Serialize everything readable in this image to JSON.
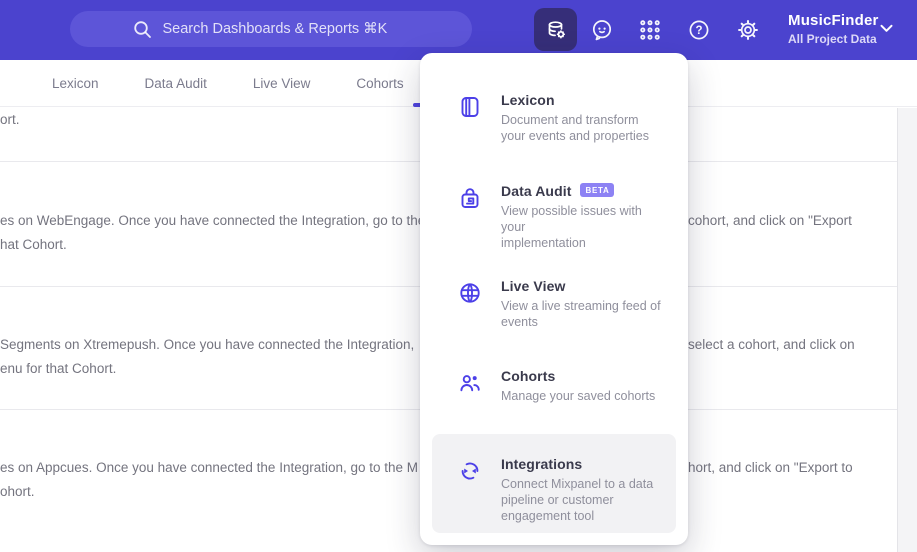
{
  "colors": {
    "header_bg": "#4b43ce",
    "search_bg": "#5d55d8",
    "header_tile_bg": "#362e79",
    "accent": "#4f44e0",
    "icon_accent": "#4c40e8",
    "badge_bg": "#8d82f4",
    "title_text": "#3a3a4c",
    "desc_text": "#8f8f9c",
    "body_text": "#74747f",
    "nav_text": "#7b7b8d",
    "divider": "#e9e9ed",
    "highlight_row": "#f2f2f4",
    "scroll_track": "#f4f4f6"
  },
  "header": {
    "search_placeholder": "Search Dashboards & Reports ⌘K",
    "project_name": "MusicFinder",
    "project_subtitle": "All Project Data",
    "help_glyph": "?",
    "icons": [
      "database-gear-icon",
      "chat-feedback-icon",
      "apps-grid-icon",
      "help-icon",
      "settings-gear-icon",
      "chevron-down-icon"
    ]
  },
  "nav": {
    "tabs": [
      {
        "label": "Lexicon"
      },
      {
        "label": "Data Audit"
      },
      {
        "label": "Live View"
      },
      {
        "label": "Cohorts"
      }
    ]
  },
  "menu": {
    "items": [
      {
        "title": "Lexicon",
        "icon": "book-icon",
        "lines": [
          "Document and transform",
          "your events and properties"
        ]
      },
      {
        "title": "Data Audit",
        "badge": "BETA",
        "icon": "audit-lock-icon",
        "lines": [
          "View possible issues with your",
          "implementation"
        ]
      },
      {
        "title": "Live View",
        "icon": "globe-icon",
        "lines": [
          "View a live streaming feed of",
          "events"
        ]
      },
      {
        "title": "Cohorts",
        "icon": "cohorts-people-icon",
        "lines": [
          "Manage your saved cohorts"
        ]
      },
      {
        "title": "Integrations",
        "icon": "integrations-sync-icon",
        "lines": [
          "Connect Mixpanel to a data",
          "pipeline or customer",
          "engagement tool"
        ]
      }
    ]
  },
  "content": {
    "row1": {
      "left_line1": "ort."
    },
    "row2": {
      "left_line1": "es on WebEngage. Once you have connected the Integration, go to the",
      "right_line1": "cohort, and click on \"Export",
      "left_line2": "hat Cohort."
    },
    "row3": {
      "left_line1": "Segments on Xtremepush. Once you have connected the Integration,",
      "right_line1": "select a cohort, and click on",
      "left_line2": "enu for that Cohort."
    },
    "row4": {
      "left_line1": "es on Appcues. Once you have connected the Integration, go to the M",
      "right_line1": "hort, and click on \"Export to",
      "left_line2": "ohort."
    }
  }
}
